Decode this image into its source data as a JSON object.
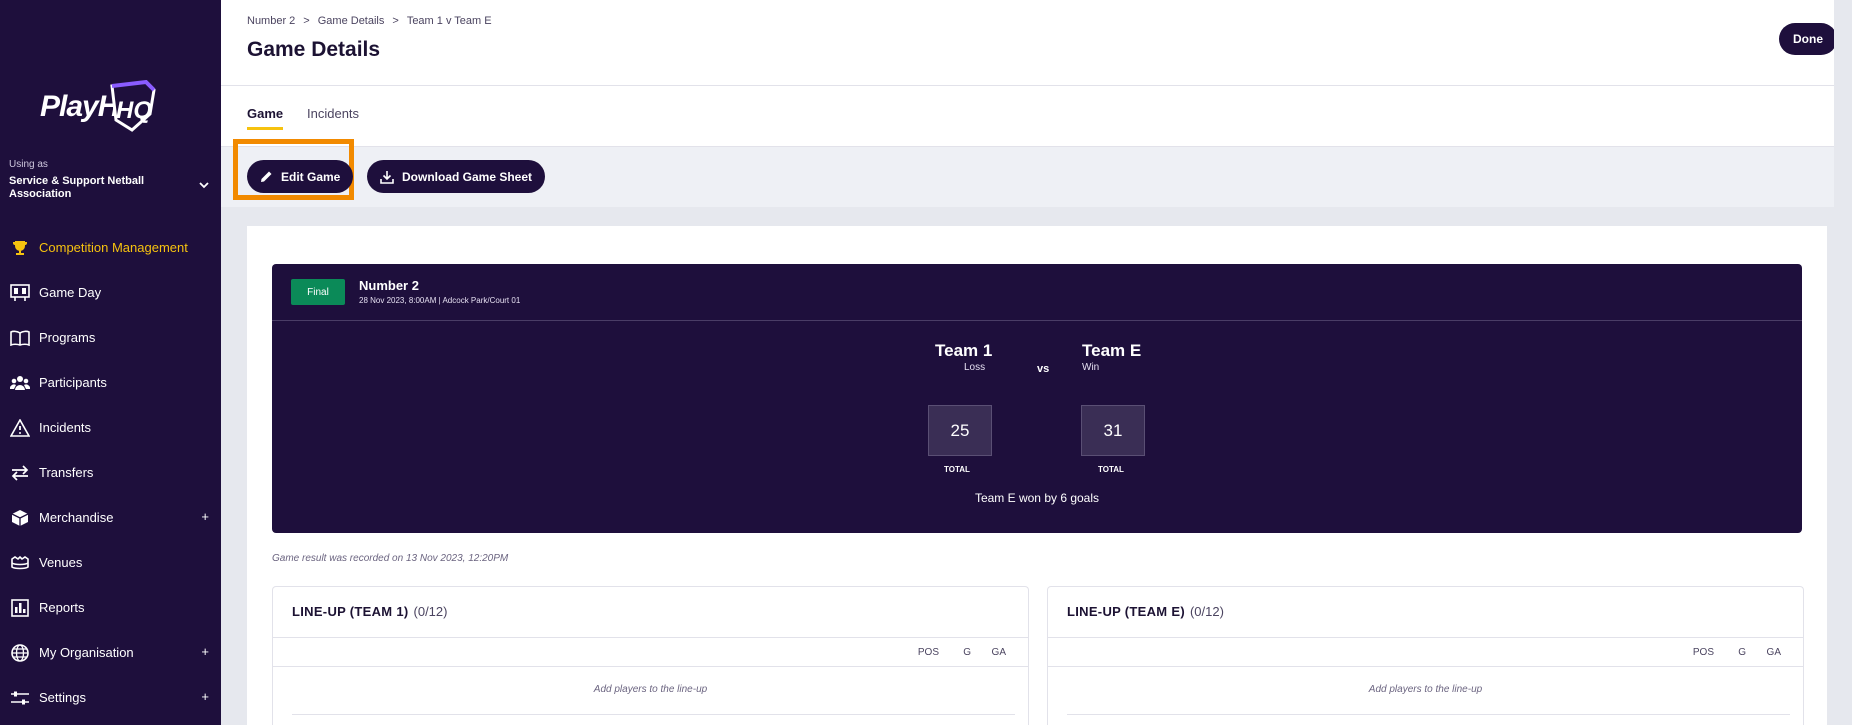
{
  "sidebar": {
    "logo": "PlayHQ",
    "using_as_label": "Using as",
    "org_name": "Service & Support Netball Association",
    "items": [
      {
        "label": "Competition Management",
        "icon": "trophy-icon",
        "active": true,
        "expandable": false
      },
      {
        "label": "Game Day",
        "icon": "scoreboard-icon",
        "active": false,
        "expandable": false
      },
      {
        "label": "Programs",
        "icon": "book-icon",
        "active": false,
        "expandable": false
      },
      {
        "label": "Participants",
        "icon": "people-icon",
        "active": false,
        "expandable": false
      },
      {
        "label": "Incidents",
        "icon": "warning-icon",
        "active": false,
        "expandable": false
      },
      {
        "label": "Transfers",
        "icon": "transfer-arrows-icon",
        "active": false,
        "expandable": false
      },
      {
        "label": "Merchandise",
        "icon": "box-icon",
        "active": false,
        "expandable": true
      },
      {
        "label": "Venues",
        "icon": "stadium-icon",
        "active": false,
        "expandable": false
      },
      {
        "label": "Reports",
        "icon": "bar-chart-icon",
        "active": false,
        "expandable": false
      },
      {
        "label": "My Organisation",
        "icon": "globe-icon",
        "active": false,
        "expandable": true
      },
      {
        "label": "Settings",
        "icon": "sliders-icon",
        "active": false,
        "expandable": true
      }
    ],
    "plus": "+"
  },
  "header": {
    "breadcrumb": [
      "Number 2",
      "Game Details",
      "Team 1 v Team E"
    ],
    "breadcrumb_sep": ">",
    "title": "Game Details",
    "done_label": "Done"
  },
  "tabs": [
    {
      "label": "Game",
      "active": true
    },
    {
      "label": "Incidents",
      "active": false
    }
  ],
  "toolbar": {
    "edit_label": "Edit Game",
    "download_label": "Download Game Sheet"
  },
  "game": {
    "status": "Final",
    "name": "Number 2",
    "meta": "28 Nov 2023, 8:00AM | Adcock Park/Court 01",
    "home": {
      "name": "Team 1",
      "result": "Loss",
      "score": "25"
    },
    "away": {
      "name": "Team E",
      "result": "Win",
      "score": "31"
    },
    "vs": "vs",
    "total_label": "TOTAL",
    "summary": "Team E won by 6 goals",
    "recorded": "Game result was recorded on 13 Nov 2023, 12:20PM"
  },
  "lineups": [
    {
      "title": "LINE-UP (TEAM 1)",
      "count": "(0/12)",
      "empty": "Add players to the line-up"
    },
    {
      "title": "LINE-UP (TEAM E)",
      "count": "(0/12)",
      "empty": "Add players to the line-up"
    }
  ],
  "lineup_columns": [
    "POS",
    "G",
    "GA"
  ],
  "colors": {
    "sidebar_bg": "#1e0f3c",
    "accent": "#f6c20f",
    "final_badge": "#0b8a58",
    "highlight": "#f28a00"
  }
}
